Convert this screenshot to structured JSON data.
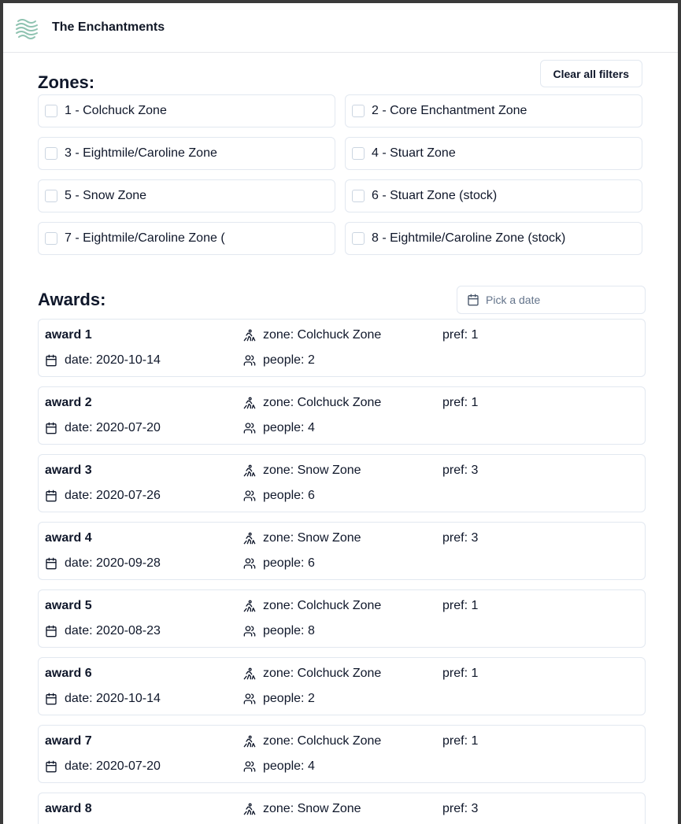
{
  "app": {
    "brand": "The Enchantments",
    "logo_icon": "wave-logo-icon",
    "accent": "#7fb8a4"
  },
  "filters": {
    "clear_label": "Clear all filters"
  },
  "zones": {
    "title": "Zones:",
    "items": [
      {
        "label": "1 - Colchuck Zone",
        "checked": false
      },
      {
        "label": "2 - Core Enchantment Zone",
        "checked": false
      },
      {
        "label": "3 - Eightmile/Caroline Zone",
        "checked": false
      },
      {
        "label": "4 - Stuart Zone",
        "checked": false
      },
      {
        "label": "5 - Snow Zone",
        "checked": false
      },
      {
        "label": "6 - Stuart Zone (stock)",
        "checked": false
      },
      {
        "label": "7 - Eightmile/Caroline Zone (",
        "checked": false
      },
      {
        "label": "8 - Eightmile/Caroline Zone (stock)",
        "checked": false
      }
    ]
  },
  "awards": {
    "title": "Awards:",
    "date_placeholder": "Pick a date",
    "items": [
      {
        "name": "award 1",
        "zone": "zone: Colchuck Zone",
        "pref": "pref: 1",
        "date": "date: 2020-10-14",
        "people": "people: 2"
      },
      {
        "name": "award 2",
        "zone": "zone: Colchuck Zone",
        "pref": "pref: 1",
        "date": "date: 2020-07-20",
        "people": "people: 4"
      },
      {
        "name": "award 3",
        "zone": "zone: Snow Zone",
        "pref": "pref: 3",
        "date": "date: 2020-07-26",
        "people": "people: 6"
      },
      {
        "name": "award 4",
        "zone": "zone: Snow Zone",
        "pref": "pref: 3",
        "date": "date: 2020-09-28",
        "people": "people: 6"
      },
      {
        "name": "award 5",
        "zone": "zone: Colchuck Zone",
        "pref": "pref: 1",
        "date": "date: 2020-08-23",
        "people": "people: 8"
      },
      {
        "name": "award 6",
        "zone": "zone: Colchuck Zone",
        "pref": "pref: 1",
        "date": "date: 2020-10-14",
        "people": "people: 2"
      },
      {
        "name": "award 7",
        "zone": "zone: Colchuck Zone",
        "pref": "pref: 1",
        "date": "date: 2020-07-20",
        "people": "people: 4"
      },
      {
        "name": "award 8",
        "zone": "zone: Snow Zone",
        "pref": "pref: 3",
        "date": "",
        "people": ""
      }
    ]
  }
}
